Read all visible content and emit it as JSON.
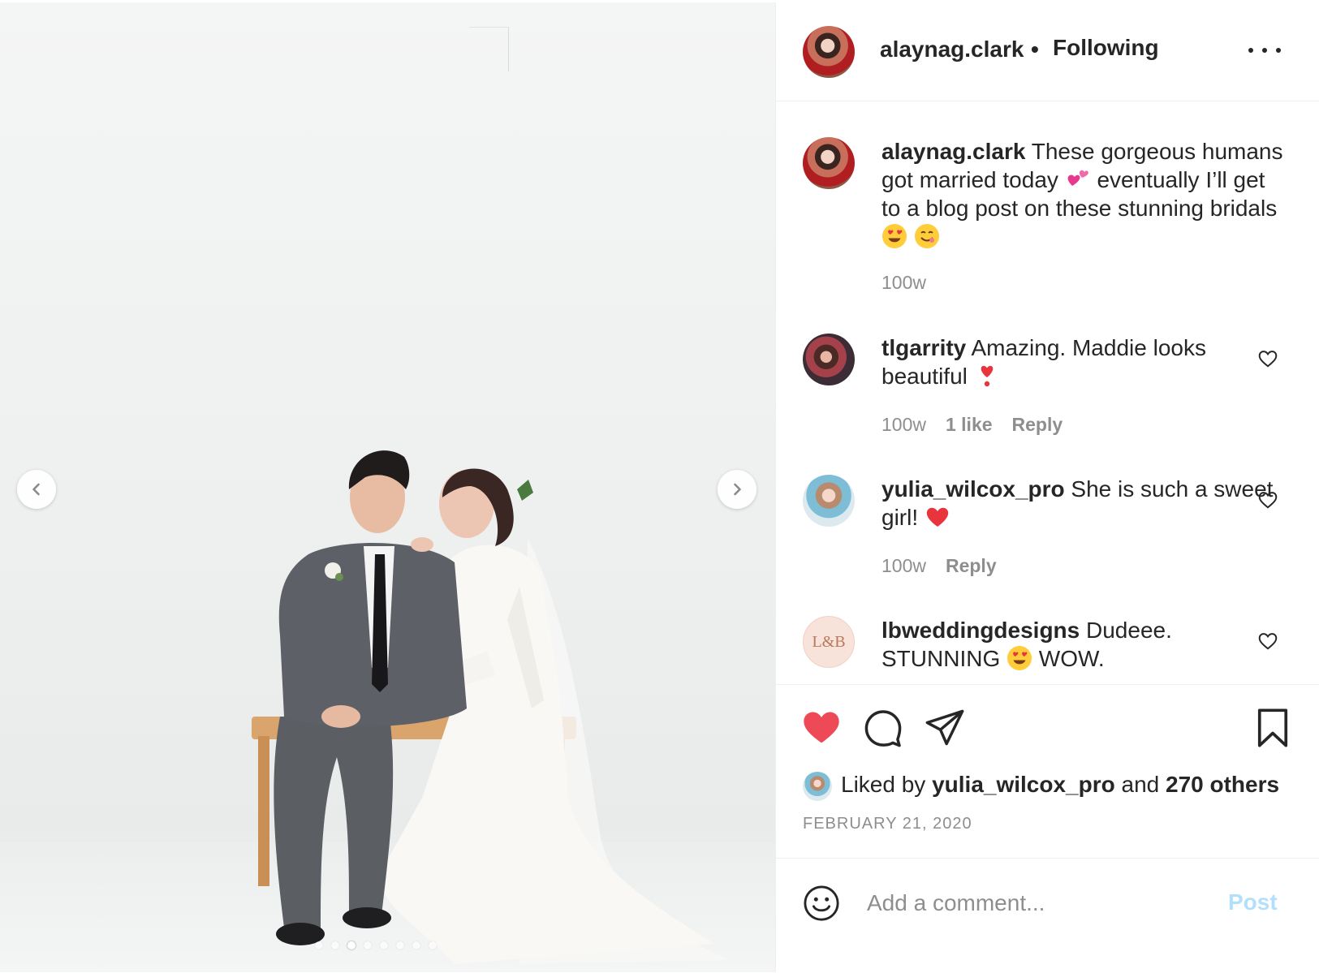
{
  "post": {
    "author": "alaynag.clark",
    "separator": "•",
    "follow_status": "Following",
    "caption": {
      "username": "alaynag.clark",
      "text_part1": "These gorgeous humans got married today",
      "text_part2": "eventually I’ll get to a blog post on these stunning bridals",
      "emojis": [
        "two-hearts-icon",
        "heart-eyes-icon",
        "smiling-face-icon"
      ],
      "timestamp": "100w"
    },
    "comments": [
      {
        "username": "tlgarrity",
        "text": "Amazing. Maddie looks beautiful",
        "emoji": "heart-exclamation-icon",
        "timestamp": "100w",
        "likes": "1 like",
        "reply": "Reply"
      },
      {
        "username": "yulia_wilcox_pro",
        "text": "She is such a sweet girl!",
        "emoji": "red-heart-icon",
        "timestamp": "100w",
        "reply": "Reply"
      },
      {
        "username": "lbweddingdesigns",
        "text_part1": "Dudeee. STUNNING",
        "emoji": "heart-eyes-icon",
        "text_part2": "WOW.",
        "avatar_text": "L&B"
      }
    ],
    "liked_by": {
      "prefix": "Liked by",
      "user": "yulia_wilcox_pro",
      "middle": "and",
      "others": "270 others"
    },
    "date": "FEBRUARY 21, 2020",
    "carousel": {
      "slide_count": 8,
      "active_index": 2
    },
    "liked": true
  },
  "composer": {
    "placeholder": "Add a comment...",
    "post_label": "Post"
  },
  "colors": {
    "like_red": "#ed4956",
    "post_disabled_blue": "#b2dffc",
    "muted_gray": "#8e8e8e",
    "text": "#262626"
  }
}
